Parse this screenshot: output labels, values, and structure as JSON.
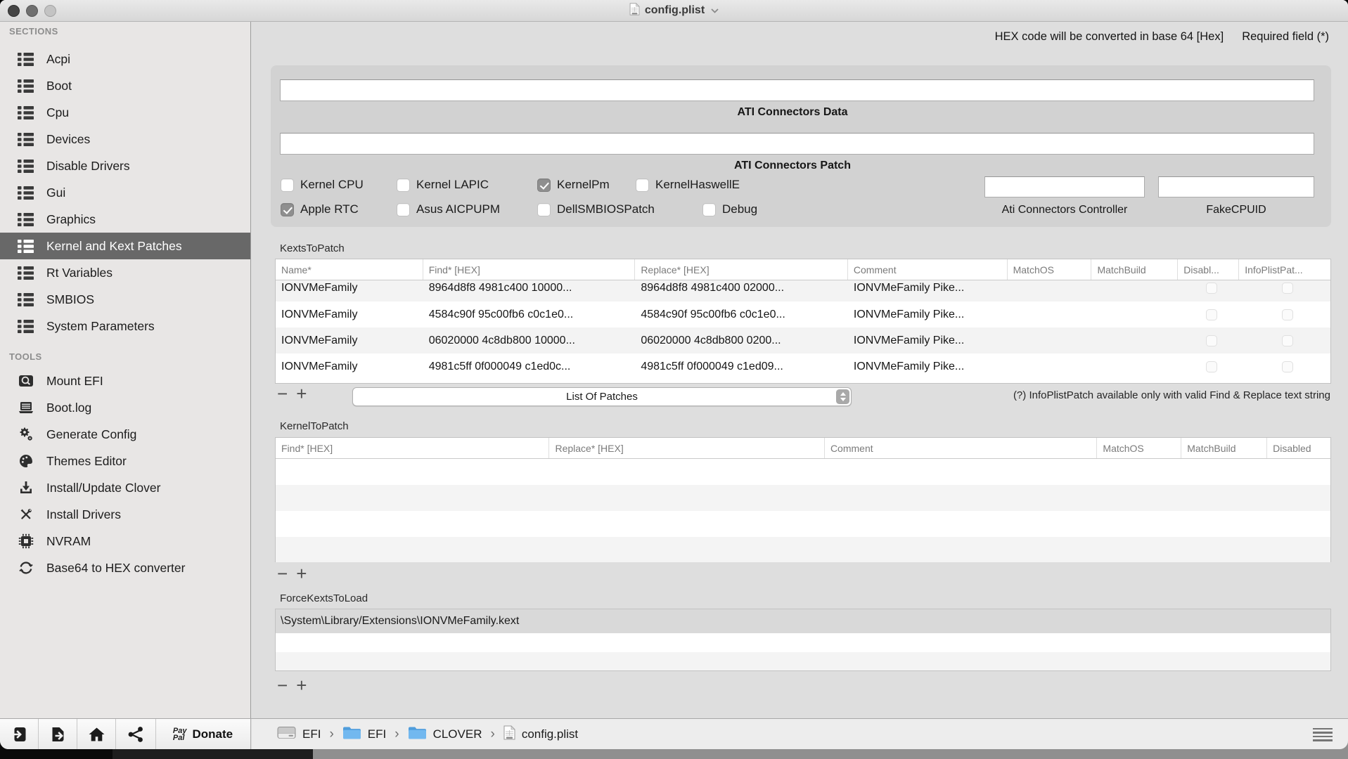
{
  "colors": {
    "accent_folder": "#5ba9e6",
    "selected_row_bg": "#686868",
    "selected_row_text": "#ffffff",
    "checked_checkbox": "#8f8f8f"
  },
  "window": {
    "title": "config.plist"
  },
  "header": {
    "note_hex": "HEX code will be converted in base 64 [Hex]",
    "note_required": "Required field (*)"
  },
  "sidebar": {
    "sections_label": "SECTIONS",
    "sections": [
      "Acpi",
      "Boot",
      "Cpu",
      "Devices",
      "Disable Drivers",
      "Gui",
      "Graphics",
      "Kernel and Kext Patches",
      "Rt Variables",
      "SMBIOS",
      "System Parameters"
    ],
    "selected_section": "Kernel and Kext Patches",
    "tools_label": "TOOLS",
    "tools": [
      "Mount EFI",
      "Boot.log",
      "Generate Config",
      "Themes Editor",
      "Install/Update Clover",
      "Install Drivers",
      "NVRAM",
      "Base64 to HEX converter"
    ]
  },
  "ati": {
    "data_label": "ATI Connectors Data",
    "patch_label": "ATI Connectors Patch",
    "data_value": "",
    "patch_value": "",
    "checkboxes_row1": [
      {
        "label": "Kernel CPU",
        "checked": false
      },
      {
        "label": "Kernel LAPIC",
        "checked": false
      },
      {
        "label": "KernelPm",
        "checked": true
      },
      {
        "label": "KernelHaswellE",
        "checked": false
      }
    ],
    "checkboxes_row2": [
      {
        "label": "Apple RTC",
        "checked": true
      },
      {
        "label": "Asus AICPUPM",
        "checked": false
      },
      {
        "label": "DellSMBIOSPatch",
        "checked": false
      },
      {
        "label": "Debug",
        "checked": false
      }
    ],
    "controller_label": "Ati Connectors Controller",
    "controller_value": "",
    "fakecpuid_label": "FakeCPUID",
    "fakecpuid_value": ""
  },
  "controls": {
    "minus": "−",
    "plus": "+"
  },
  "kexts_to_patch": {
    "title": "KextsToPatch",
    "columns": [
      "Name*",
      "Find* [HEX]",
      "Replace* [HEX]",
      "Comment",
      "MatchOS",
      "MatchBuild",
      "Disabl...",
      "InfoPlistPat..."
    ],
    "rows": [
      {
        "name": "IONVMeFamily",
        "find": "8964d8f8 4981c400 10000...",
        "replace": "8964d8f8 4981c400 02000...",
        "comment": "IONVMeFamily Pike...",
        "disabled": false,
        "infoplistpatch": false
      },
      {
        "name": "IONVMeFamily",
        "find": "4584c90f 95c00fb6 c0c1e0...",
        "replace": "4584c90f 95c00fb6 c0c1e0...",
        "comment": "IONVMeFamily Pike...",
        "disabled": false,
        "infoplistpatch": false
      },
      {
        "name": "IONVMeFamily",
        "find": "06020000 4c8db800 10000...",
        "replace": "06020000 4c8db800 0200...",
        "comment": "IONVMeFamily Pike...",
        "disabled": false,
        "infoplistpatch": false
      },
      {
        "name": "IONVMeFamily",
        "find": "4981c5ff 0f000049 c1ed0c...",
        "replace": "4981c5ff 0f000049 c1ed09...",
        "comment": "IONVMeFamily Pike...",
        "disabled": false,
        "infoplistpatch": false
      }
    ],
    "dropdown_value": "List Of Patches",
    "note": "(?) InfoPlistPatch available only with valid Find & Replace text string"
  },
  "kernel_to_patch": {
    "title": "KernelToPatch",
    "columns": [
      "Find* [HEX]",
      "Replace* [HEX]",
      "Comment",
      "MatchOS",
      "MatchBuild",
      "Disabled"
    ],
    "rows": []
  },
  "force_kexts": {
    "title": "ForceKextsToLoad",
    "items": [
      "\\System\\Library/Extensions\\IONVMeFamily.kext"
    ]
  },
  "footer": {
    "paypal_line1": "Pay",
    "paypal_line2": "Pal",
    "donate_label": "Donate",
    "breadcrumb_separator": "›",
    "breadcrumb": [
      {
        "label": "EFI",
        "icon": "disk-icon"
      },
      {
        "label": "EFI",
        "icon": "folder-icon"
      },
      {
        "label": "CLOVER",
        "icon": "folder-icon"
      },
      {
        "label": "config.plist",
        "icon": "plist-icon"
      }
    ]
  }
}
